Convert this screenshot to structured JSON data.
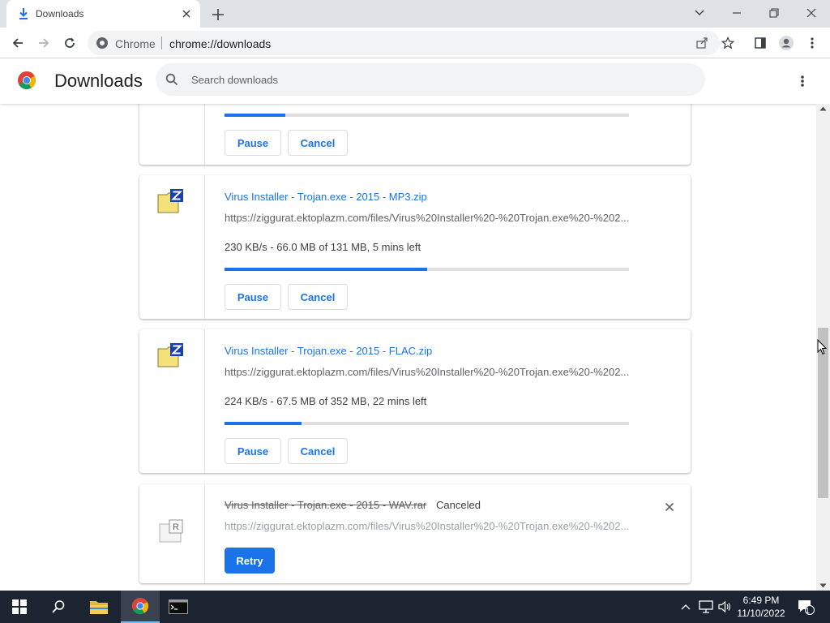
{
  "window": {
    "tab_title": "Downloads",
    "accent": "#1a73e8"
  },
  "toolbar": {
    "omnibox_site": "Chrome",
    "omnibox_url": "chrome://downloads"
  },
  "header": {
    "title": "Downloads",
    "search_placeholder": "Search downloads"
  },
  "downloads": [
    {
      "state": "in_progress",
      "progress": 0.15,
      "pause_label": "Pause",
      "cancel_label": "Cancel"
    },
    {
      "state": "in_progress",
      "name": "Virus Installer - Trojan.exe - 2015 - MP3.zip",
      "url": "https://ziggurat.ektoplazm.com/files/Virus%20Installer%20-%20Trojan.exe%20-%202...",
      "description": "230 KB/s - 66.0 MB of 131 MB, 5 mins left",
      "progress": 0.5,
      "pause_label": "Pause",
      "cancel_label": "Cancel"
    },
    {
      "state": "in_progress",
      "name": "Virus Installer - Trojan.exe - 2015 - FLAC.zip",
      "url": "https://ziggurat.ektoplazm.com/files/Virus%20Installer%20-%20Trojan.exe%20-%202...",
      "description": "224 KB/s - 67.5 MB of 352 MB, 22 mins left",
      "progress": 0.19,
      "pause_label": "Pause",
      "cancel_label": "Cancel"
    },
    {
      "state": "canceled",
      "name": "Virus Installer - Trojan.exe - 2015 - WAV.rar",
      "status": "Canceled",
      "url": "https://ziggurat.ektoplazm.com/files/Virus%20Installer%20-%20Trojan.exe%20-%202...",
      "retry_label": "Retry"
    }
  ],
  "taskbar": {
    "time": "6:49 PM",
    "date": "11/10/2022",
    "notification_count": "1"
  }
}
